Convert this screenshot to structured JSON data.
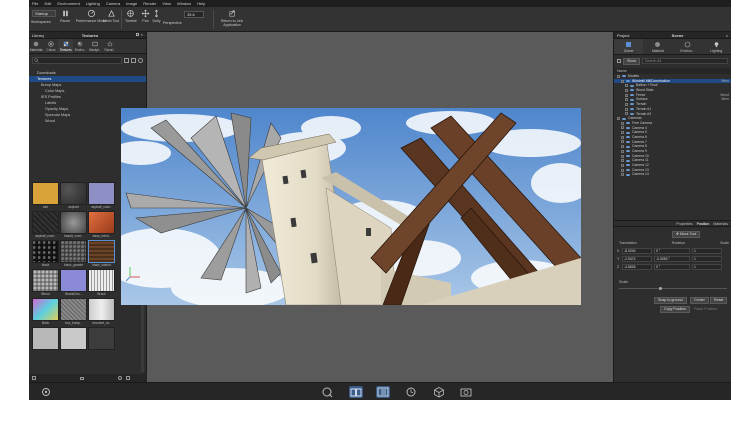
{
  "menu": [
    "File",
    "Edit",
    "Environment",
    "Lighting",
    "Camera",
    "Image",
    "Render",
    "View",
    "Window",
    "Help"
  ],
  "toolbar": {
    "startup_value": "Startup",
    "items": [
      {
        "label": "Workspaces",
        "icon": "workspaces-icon"
      },
      {
        "label": "Pause",
        "icon": "pause-icon"
      },
      {
        "label": "Performance Mode",
        "icon": "performance-icon"
      },
      {
        "label": "Mesh Tool",
        "icon": "mesh-tool-icon"
      },
      {
        "label": "Tumble",
        "icon": "tumble-icon"
      },
      {
        "label": "Pan",
        "icon": "pan-icon"
      },
      {
        "label": "Dolly",
        "icon": "dolly-icon"
      },
      {
        "label": "Perspective",
        "icon": "perspective-icon"
      },
      {
        "label": "Return to Link Application",
        "icon": "return-link-icon"
      }
    ],
    "fov_value": "35.6"
  },
  "library": {
    "panel_title": "Library",
    "center_title": "Textures",
    "tabs": [
      "Materials",
      "Colors",
      "Textures",
      "Enviro..",
      "Backpl..",
      "Favori.."
    ],
    "active_tab": 2,
    "tree": [
      {
        "label": "Downloads",
        "indent": 0
      },
      {
        "label": "Textures",
        "indent": 0,
        "selected": true
      },
      {
        "label": "Bump Maps",
        "indent": 1
      },
      {
        "label": "Color Maps",
        "indent": 2
      },
      {
        "label": "IES Profiles",
        "indent": 1
      },
      {
        "label": "Labels",
        "indent": 2
      },
      {
        "label": "Opacity Maps",
        "indent": 2
      },
      {
        "label": "Specular Maps",
        "indent": 2
      },
      {
        "label": "Wood",
        "indent": 2
      }
    ],
    "thumbnails": [
      {
        "caption": "ash",
        "color": "#d9a33a"
      },
      {
        "caption": "asphalt",
        "color": "#3a3a3a"
      },
      {
        "caption": "asphalt_cove..",
        "color": "#8e8fc4"
      },
      {
        "caption": "asphalt_cove..",
        "color": "#2a2a2a"
      },
      {
        "caption": "basalt_cove..",
        "color": "#6a6a6a"
      },
      {
        "caption": "basa_retrol..",
        "color": "#c2542a"
      },
      {
        "caption": "black",
        "color": "#151515"
      },
      {
        "caption": "black_granite",
        "color": "#4a4a4a"
      },
      {
        "caption": "black_walnut",
        "color": "#5a3b22"
      },
      {
        "caption": "Blend",
        "color": "#9a9a9a"
      },
      {
        "caption": "BluestCho..",
        "color": "#8a8ad6"
      },
      {
        "caption": "Brack",
        "color": "#e0e0e0"
      },
      {
        "caption": "Brick",
        "color": "#d26ad0"
      },
      {
        "caption": "box_bump..",
        "color": "#787878"
      },
      {
        "caption": "brushed_ra..",
        "color": "#d6d6d6"
      },
      {
        "caption": "",
        "color": "#b8b8b8"
      },
      {
        "caption": "",
        "color": "#c9c9c9"
      },
      {
        "caption": "",
        "color": "#3c3c3c"
      }
    ]
  },
  "scene": {
    "panel_title": "Project",
    "center_title": "Scene",
    "tabs": [
      "Scene",
      "Material",
      "Environ..",
      "Lighting",
      "Camera"
    ],
    "active_tab": 0,
    "filter_button": "Show",
    "search_placeholder": "Search All",
    "column_name": "Name",
    "objects": [
      {
        "label": "Models",
        "indent": 0
      },
      {
        "label": "Windmill MillConstruction",
        "indent": 1,
        "selected": true,
        "side": "Mem"
      },
      {
        "label": "Balkon + Roof",
        "indent": 2
      },
      {
        "label": "Wood Slats",
        "indent": 2
      },
      {
        "label": "Fence",
        "indent": 2,
        "side": "Wood"
      },
      {
        "label": "Surface",
        "indent": 2,
        "side": "Mem"
      },
      {
        "label": "Terrain",
        "indent": 2
      },
      {
        "label": "Terrain #1",
        "indent": 2
      },
      {
        "label": "Terrain #3",
        "indent": 2
      },
      {
        "label": "Cameras",
        "indent": 0
      },
      {
        "label": "Free Camera",
        "indent": 1
      },
      {
        "label": "Camera 4",
        "indent": 1
      },
      {
        "label": "Camera 5",
        "indent": 1
      },
      {
        "label": "Camera 6",
        "indent": 1
      },
      {
        "label": "Camera 7",
        "indent": 1
      },
      {
        "label": "Camera 8",
        "indent": 1
      },
      {
        "label": "Camera 9",
        "indent": 1
      },
      {
        "label": "Camera 10",
        "indent": 1
      },
      {
        "label": "Camera 11",
        "indent": 1
      },
      {
        "label": "Camera 12",
        "indent": 1
      },
      {
        "label": "Camera 13",
        "indent": 1
      },
      {
        "label": "Camera 14",
        "indent": 1
      }
    ],
    "prop_tabs": [
      "Properties",
      "Position",
      "Materials"
    ],
    "active_prop_tab": 1,
    "move_tool": "Move Tool",
    "translation_label": "Translation",
    "rotation_label": "Rotation",
    "scale_label": "Scale",
    "rows": [
      {
        "axis": "X",
        "translation": "-8.0240",
        "rotation": "0 °",
        "scale": "1"
      },
      {
        "axis": "Y",
        "translation": "-2.9474",
        "rotation": "-0.0053 °",
        "scale": "1"
      },
      {
        "axis": "Z",
        "translation": "-4.5526",
        "rotation": "0 °",
        "scale": "1"
      }
    ],
    "scale_row_label": "Scale",
    "buttons": [
      "Snap to ground",
      "Center",
      "Reset",
      "Copy Position",
      "Paste Position"
    ]
  },
  "bottombar": {
    "icons": [
      "settings-icon",
      "render-icon",
      "book-icon",
      "sidebar-icon",
      "history-icon",
      "cube-icon",
      "snapshot-icon"
    ],
    "active": [
      2,
      3
    ]
  },
  "colors": {
    "selection": "#1f4a86",
    "accent": "#3b5c8a",
    "sky_top": "#4f86cc",
    "sky_bottom": "#a9c7e8",
    "tower": "#e6e0cd",
    "wood": "#5a3520"
  }
}
